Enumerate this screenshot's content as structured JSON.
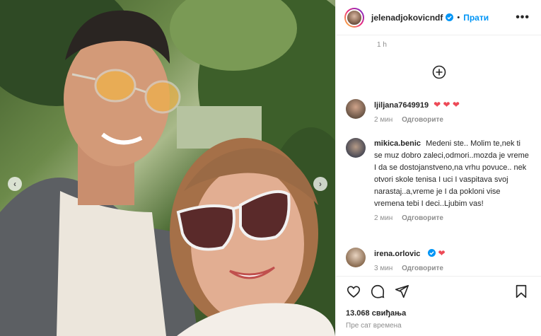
{
  "post": {
    "username": "jelenadjokovicndf",
    "dot": "•",
    "follow_label": "Прати",
    "more_label": "•••",
    "likes": "13.068 свиђања",
    "posted_ago": "Пре сат времена"
  },
  "comments_area": {
    "top_time": "1 h"
  },
  "comments": [
    {
      "user": "ljiljana7649919",
      "text": "",
      "hearts": "❤ ❤ ❤",
      "time": "2 мин",
      "reply": "Одговорите"
    },
    {
      "user": "mikica.benic",
      "text": "Medeni ste.. Molim te,nek ti se muz dobro zaleci,odmori..mozda je vreme I da se dostojanstveno,na vrhu povuce.. nek otvori skole tenisa I uci I vaspitava svoj narastaj..a,vreme je I da pokloni vise vremena tebi I deci..Ljubim vas!",
      "time": "2 мин",
      "reply": "Одговорите"
    },
    {
      "user": "irena.orlovic",
      "text": "",
      "hearts": "❤",
      "time": "3 мин",
      "reply": "Одговорите"
    }
  ],
  "colors": {
    "accent": "#0095f6",
    "heart": "#ed4956",
    "muted": "#8e8e8e"
  },
  "icons": [
    "chevron-left-icon",
    "chevron-right-icon",
    "plus-circle-icon",
    "heart-icon",
    "comment-icon",
    "share-icon",
    "bookmark-icon",
    "verified-badge-icon"
  ]
}
